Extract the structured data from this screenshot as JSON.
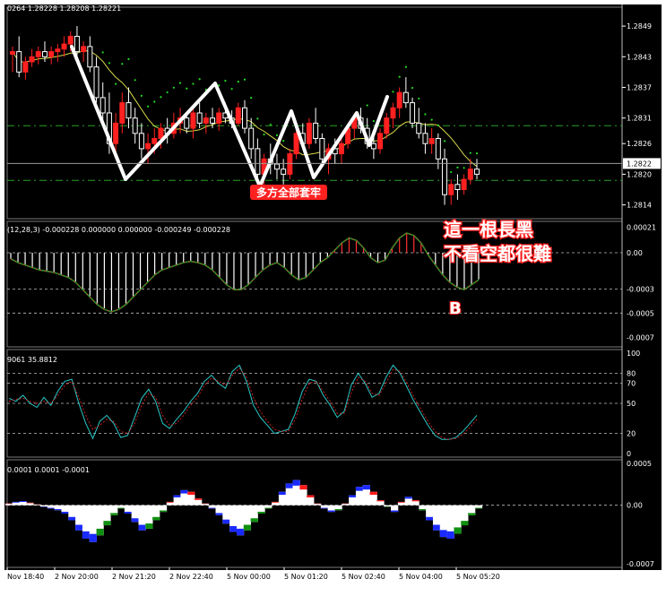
{
  "colors": {
    "background": "#000000",
    "frame": "#ffffff",
    "grid": "#d8d8d8",
    "up": "#ff2020",
    "down": "#ffffff",
    "ma_long": "#d8d84a",
    "sar": "#22dd22",
    "sar_dash": "#2aa02a",
    "annotation": "#ffffff",
    "annotation_box": "#ff2020",
    "hist_green": "#2a8f2a",
    "hist_red": "#ff3030",
    "rsi_cyan": "#2ac8c8",
    "rsi_red": "#cc2020",
    "osc_blue": "#1a2aff",
    "osc_green": "#109010",
    "osc_white": "#ffffff",
    "osc_red": "#ff1a1a"
  },
  "main_panel": {
    "header": "0264 1.28228 1.28208 1.28221",
    "ticks": [
      "1.2849",
      "1.2843",
      "1.2837",
      "1.2831",
      "1.2826",
      "1.2820",
      "1.2814"
    ],
    "current_price": "1.2822",
    "annotations": {
      "trap": "多方全部套牢",
      "bar_line1": "這一根長黑",
      "bar_line2": "不看空都很難"
    }
  },
  "macd_panel": {
    "header": "(12,28,3) -0.000228 0.000000 0.000000 -0.000249 -0.000228",
    "ticks": [
      "0.00021",
      "0.00",
      "-0.0003",
      "-0.0005",
      "-0.0007"
    ],
    "label_b": "B"
  },
  "stoch_panel": {
    "header": "9061 35.8812",
    "ticks": [
      "100",
      "80",
      "70",
      "50",
      "20",
      "0"
    ]
  },
  "osc_panel": {
    "header": "0.0001 0.0001 -0.0001",
    "ticks": [
      "0.0005",
      "0.00",
      "-0.0007"
    ]
  },
  "time_axis": [
    "Nov 18:40",
    "2 Nov 20:00",
    "2 Nov 21:20",
    "2 Nov 22:40",
    "5 Nov 00:00",
    "5 Nov 01:20",
    "5 Nov 02:40",
    "5 Nov 04:00",
    "5 Nov 05:20"
  ],
  "chart_data": [
    {
      "type": "candlestick",
      "title": "",
      "ylim": [
        1.2812,
        1.2852
      ],
      "y_ticks": [
        1.2849,
        1.2843,
        1.2837,
        1.2831,
        1.2826,
        1.282,
        1.2814
      ],
      "ohlc": [
        [
          1.28435,
          1.2845,
          1.284,
          1.2844
        ],
        [
          1.2844,
          1.2847,
          1.2839,
          1.284
        ],
        [
          1.284,
          1.2843,
          1.28385,
          1.2842
        ],
        [
          1.2842,
          1.28445,
          1.2841,
          1.2843
        ],
        [
          1.2843,
          1.2845,
          1.28415,
          1.2844
        ],
        [
          1.2844,
          1.2846,
          1.2842,
          1.2843
        ],
        [
          1.2843,
          1.2845,
          1.28415,
          1.2844
        ],
        [
          1.2844,
          1.28455,
          1.2842,
          1.28445
        ],
        [
          1.28445,
          1.2847,
          1.2843,
          1.28455
        ],
        [
          1.28455,
          1.2848,
          1.2844,
          1.2847
        ],
        [
          1.2847,
          1.2849,
          1.2843,
          1.2844
        ],
        [
          1.2844,
          1.2846,
          1.2842,
          1.2845
        ],
        [
          1.2845,
          1.2847,
          1.284,
          1.2841
        ],
        [
          1.2841,
          1.2843,
          1.2834,
          1.2835
        ],
        [
          1.2835,
          1.2838,
          1.283,
          1.2832
        ],
        [
          1.2832,
          1.2836,
          1.2824,
          1.2826
        ],
        [
          1.2826,
          1.2832,
          1.2824,
          1.283
        ],
        [
          1.283,
          1.2836,
          1.2828,
          1.2834
        ],
        [
          1.2834,
          1.2837,
          1.2829,
          1.2831
        ],
        [
          1.2831,
          1.2833,
          1.2826,
          1.2828
        ],
        [
          1.2828,
          1.283,
          1.2823,
          1.2825
        ],
        [
          1.2825,
          1.2828,
          1.2822,
          1.2826
        ],
        [
          1.2826,
          1.2829,
          1.2824,
          1.2827
        ],
        [
          1.2827,
          1.283,
          1.2825,
          1.2829
        ],
        [
          1.2829,
          1.2831,
          1.2826,
          1.2828
        ],
        [
          1.2828,
          1.2832,
          1.2827,
          1.283
        ],
        [
          1.283,
          1.2833,
          1.2828,
          1.2831
        ],
        [
          1.2831,
          1.2832,
          1.2828,
          1.2829
        ],
        [
          1.2829,
          1.2833,
          1.2827,
          1.2832
        ],
        [
          1.2832,
          1.2834,
          1.2829,
          1.283
        ],
        [
          1.283,
          1.2832,
          1.2828,
          1.2831
        ],
        [
          1.2831,
          1.2833,
          1.2829,
          1.283
        ],
        [
          1.283,
          1.2833,
          1.28285,
          1.2832
        ],
        [
          1.2832,
          1.2834,
          1.283,
          1.2831
        ],
        [
          1.2831,
          1.28325,
          1.2829,
          1.283
        ],
        [
          1.283,
          1.2834,
          1.28295,
          1.2833
        ],
        [
          1.2833,
          1.28345,
          1.2828,
          1.2829
        ],
        [
          1.2829,
          1.2831,
          1.2823,
          1.2825
        ],
        [
          1.2825,
          1.2827,
          1.2818,
          1.282
        ],
        [
          1.282,
          1.2824,
          1.2817,
          1.2823
        ],
        [
          1.2823,
          1.2826,
          1.282,
          1.2822
        ],
        [
          1.2822,
          1.2824,
          1.2819,
          1.2821
        ],
        [
          1.2821,
          1.2823,
          1.2818,
          1.282
        ],
        [
          1.282,
          1.2825,
          1.2819,
          1.2824
        ],
        [
          1.2824,
          1.2829,
          1.2823,
          1.2828
        ],
        [
          1.2828,
          1.283,
          1.2825,
          1.2826
        ],
        [
          1.2826,
          1.2831,
          1.2825,
          1.283
        ],
        [
          1.283,
          1.2833,
          1.2826,
          1.2827
        ],
        [
          1.2827,
          1.2828,
          1.2822,
          1.2823
        ],
        [
          1.2823,
          1.2826,
          1.282,
          1.2825
        ],
        [
          1.2825,
          1.2827,
          1.2822,
          1.2824
        ],
        [
          1.2824,
          1.2827,
          1.2822,
          1.2826
        ],
        [
          1.2826,
          1.283,
          1.2825,
          1.2829
        ],
        [
          1.2829,
          1.2832,
          1.2827,
          1.2831
        ],
        [
          1.2831,
          1.2833,
          1.2828,
          1.2829
        ],
        [
          1.2829,
          1.2831,
          1.2825,
          1.2826
        ],
        [
          1.2826,
          1.2828,
          1.2823,
          1.2825
        ],
        [
          1.2825,
          1.2829,
          1.2824,
          1.2828
        ],
        [
          1.2828,
          1.2832,
          1.2827,
          1.2831
        ],
        [
          1.2831,
          1.2834,
          1.2829,
          1.2833
        ],
        [
          1.2833,
          1.2837,
          1.2831,
          1.2836
        ],
        [
          1.2836,
          1.2839,
          1.2833,
          1.2834
        ],
        [
          1.2834,
          1.2835,
          1.2829,
          1.283
        ],
        [
          1.283,
          1.2833,
          1.2827,
          1.2828
        ],
        [
          1.2828,
          1.283,
          1.2824,
          1.2826
        ],
        [
          1.2826,
          1.2829,
          1.2824,
          1.2827
        ],
        [
          1.2827,
          1.2828,
          1.2821,
          1.2823
        ],
        [
          1.2823,
          1.2825,
          1.2814,
          1.2816
        ],
        [
          1.2816,
          1.2819,
          1.2814,
          1.2818
        ],
        [
          1.2818,
          1.282,
          1.2815,
          1.2817
        ],
        [
          1.2817,
          1.282,
          1.2816,
          1.2819
        ],
        [
          1.2819,
          1.2823,
          1.2818,
          1.2821
        ],
        [
          1.2821,
          1.2823,
          1.2819,
          1.282
        ]
      ],
      "overlays": [
        "moving average (yellow)",
        "parabolic SAR (green dots)",
        "hand-drawn zigzag (white)",
        "horizontal dash-dot levels (green)"
      ]
    },
    {
      "type": "bar",
      "title": "",
      "ylim": [
        -0.00075,
        0.00023
      ],
      "series_kind": "histogram with signal line",
      "values": [
        -5e-05,
        -8e-05,
        -0.0001,
        -0.00012,
        -0.00014,
        -0.00015,
        -0.00016,
        -0.00018,
        -0.0002,
        -0.00024,
        -0.0003,
        -0.00036,
        -0.00042,
        -0.00046,
        -0.00048,
        -0.00046,
        -0.00042,
        -0.00036,
        -0.0003,
        -0.00024,
        -0.00018,
        -0.00014,
        -0.00012,
        -0.0001,
        -8e-05,
        -7e-05,
        -8e-05,
        -0.0001,
        -0.00014,
        -0.0002,
        -0.00026,
        -0.0003,
        -0.0003,
        -0.00026,
        -0.0002,
        -0.00014,
        -0.0001,
        -8e-05,
        -0.00012,
        -0.00018,
        -0.00022,
        -0.0002,
        -0.00014,
        -8e-05,
        -4e-05,
        2e-05,
        8e-05,
        0.00012,
        0.0001,
        4e-05,
        -4e-05,
        -8e-05,
        -6e-05,
        4e-05,
        0.00012,
        0.00016,
        0.00014,
        8e-05,
        -2e-05,
        -0.0001,
        -0.00018,
        -0.00024,
        -0.00028,
        -0.0003,
        -0.00026,
        -0.00022
      ]
    },
    {
      "type": "line",
      "title": "",
      "ylim": [
        0,
        100
      ],
      "levels": [
        80,
        70,
        50,
        20
      ],
      "series": [
        {
          "values": [
            55,
            52,
            58,
            50,
            46,
            56,
            48,
            62,
            72,
            74,
            50,
            30,
            15,
            32,
            38,
            30,
            16,
            18,
            36,
            55,
            64,
            52,
            30,
            25,
            34,
            42,
            52,
            60,
            72,
            78,
            70,
            65,
            82,
            88,
            72,
            48,
            36,
            28,
            20,
            22,
            24,
            40,
            62,
            74,
            72,
            58,
            48,
            36,
            42,
            68,
            80,
            70,
            56,
            60,
            76,
            88,
            80,
            66,
            52,
            40,
            28,
            18,
            14,
            14,
            16,
            22,
            30,
            38
          ]
        },
        {
          "values": [
            52,
            54,
            55,
            52,
            50,
            52,
            50,
            58,
            68,
            72,
            56,
            38,
            24,
            28,
            34,
            32,
            22,
            20,
            30,
            48,
            60,
            56,
            38,
            28,
            30,
            38,
            48,
            56,
            68,
            75,
            72,
            68,
            78,
            85,
            76,
            56,
            42,
            32,
            24,
            22,
            22,
            34,
            54,
            70,
            72,
            62,
            52,
            40,
            40,
            60,
            76,
            72,
            60,
            58,
            70,
            84,
            82,
            70,
            56,
            44,
            32,
            22,
            16,
            14,
            15,
            19,
            26,
            34
          ]
        }
      ]
    },
    {
      "type": "bar",
      "title": "",
      "ylim": [
        -0.0007,
        0.0005
      ],
      "values": [
        2e-05,
        4e-05,
        5e-05,
        3e-05,
        1e-05,
        -2e-05,
        -4e-05,
        -6e-05,
        -0.0001,
        -0.00018,
        -0.0003,
        -0.0004,
        -0.00044,
        -0.00036,
        -0.00024,
        -0.00012,
        -4e-05,
        -0.0001,
        -0.0002,
        -0.0003,
        -0.00028,
        -0.00018,
        -8e-05,
        4e-05,
        0.00012,
        0.00018,
        0.00016,
        8e-05,
        2e-05,
        -4e-05,
        -0.00012,
        -0.00022,
        -0.00032,
        -0.00036,
        -0.0003,
        -0.0002,
        -0.0001,
        -4e-05,
        4e-05,
        0.00016,
        0.00026,
        0.0003,
        0.00024,
        0.00012,
        2e-05,
        -4e-05,
        -8e-05,
        -6e-05,
        2e-05,
        0.00012,
        0.00022,
        0.00024,
        0.00016,
        6e-05,
        -2e-05,
        -8e-05,
        4e-05,
        0.0001,
        6e-05,
        -6e-05,
        -0.00018,
        -0.0003,
        -0.00038,
        -0.0004,
        -0.00034,
        -0.00024,
        -0.00012,
        -4e-05
      ]
    }
  ]
}
